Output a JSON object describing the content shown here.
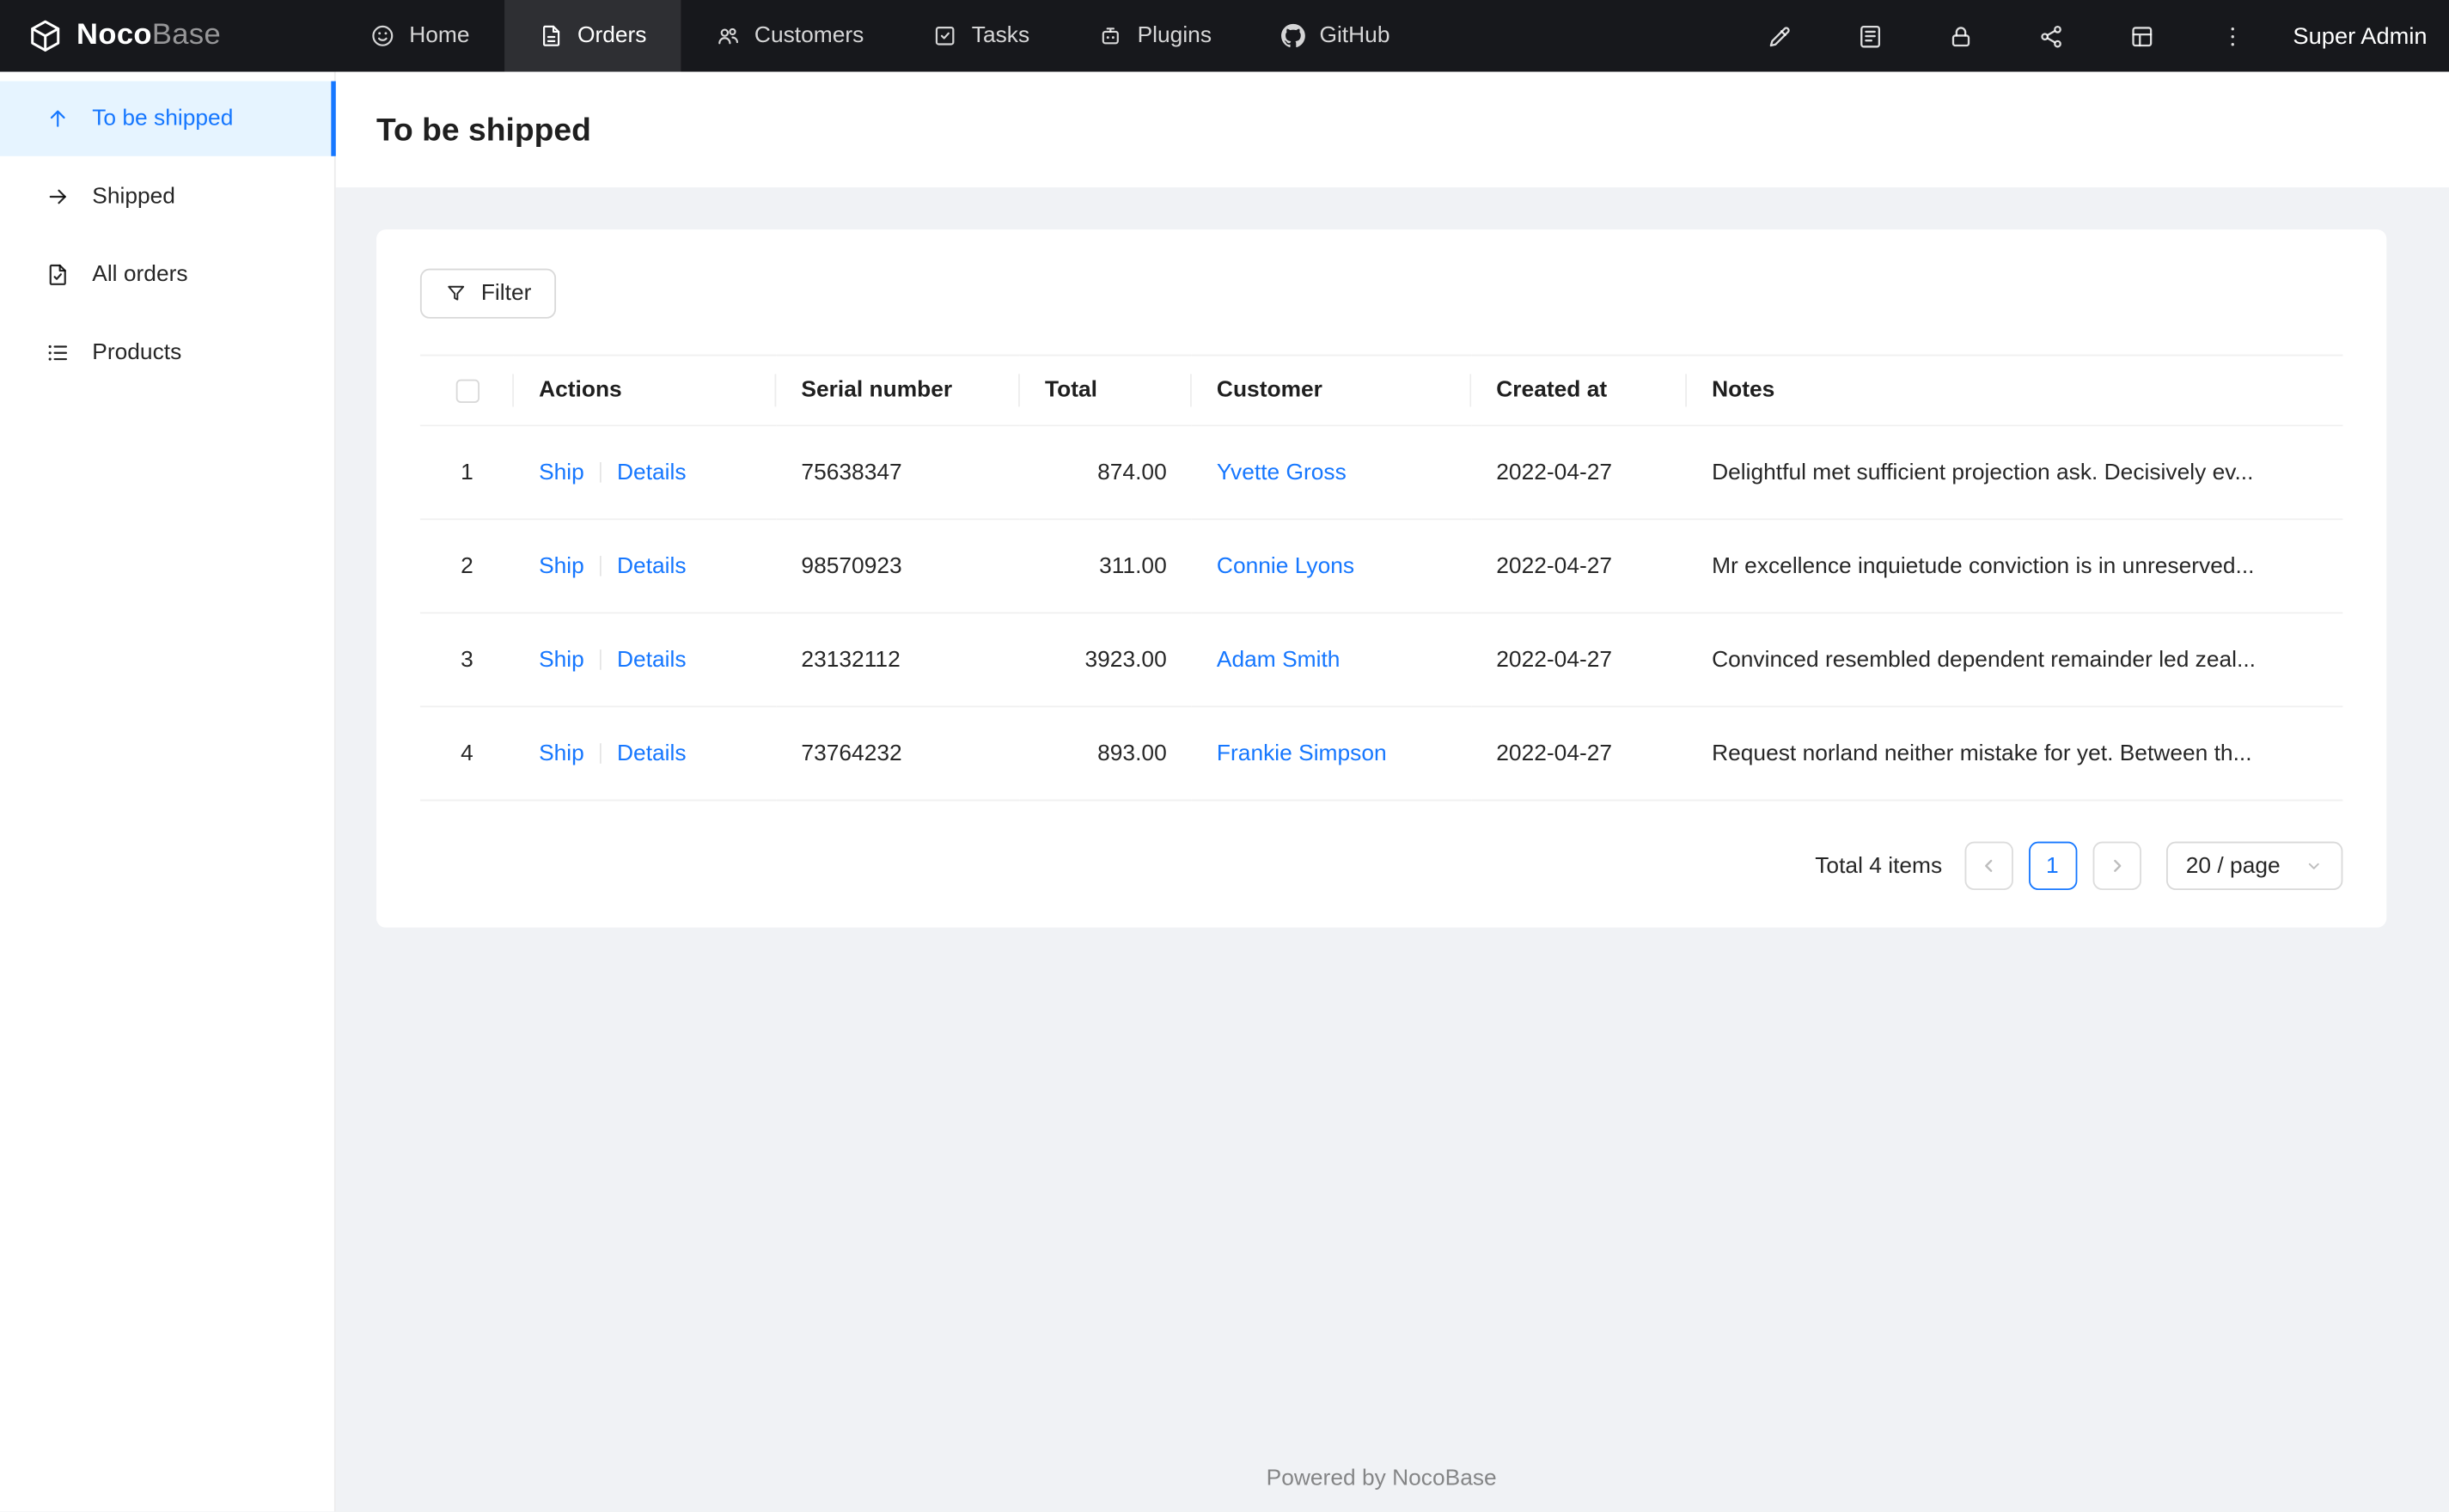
{
  "navbar": {
    "logo": {
      "noco": "Noco",
      "base": "Base",
      "icon": "cube-logo-icon"
    },
    "items": [
      {
        "label": "Home",
        "icon": "smile-icon",
        "active": false
      },
      {
        "label": "Orders",
        "icon": "orders-icon",
        "active": true
      },
      {
        "label": "Customers",
        "icon": "team-icon",
        "active": false
      },
      {
        "label": "Tasks",
        "icon": "check-square-icon",
        "active": false
      },
      {
        "label": "Plugins",
        "icon": "robot-icon",
        "active": false
      },
      {
        "label": "GitHub",
        "icon": "github-icon",
        "active": false
      }
    ],
    "right_icons": [
      "highlighter-icon",
      "collections-icon",
      "lock-icon",
      "share-icon",
      "layout-icon",
      "more-icon"
    ],
    "user": "Super Admin"
  },
  "sidebar": {
    "items": [
      {
        "label": "To be shipped",
        "icon": "arrow-up-icon",
        "active": true
      },
      {
        "label": "Shipped",
        "icon": "arrow-right-icon",
        "active": false
      },
      {
        "label": "All orders",
        "icon": "order-file-icon",
        "active": false
      },
      {
        "label": "Products",
        "icon": "list-icon",
        "active": false
      }
    ]
  },
  "page": {
    "title": "To be shipped"
  },
  "table": {
    "filter_label": "Filter",
    "columns": [
      "Actions",
      "Serial number",
      "Total",
      "Customer",
      "Created at",
      "Notes"
    ],
    "rows": [
      {
        "index": 1,
        "actions": [
          "Ship",
          "Details"
        ],
        "serial": "75638347",
        "total": "874.00",
        "customer": "Yvette Gross",
        "created_at": "2022-04-27",
        "notes": "Delightful met sufficient projection ask. Decisively ev..."
      },
      {
        "index": 2,
        "actions": [
          "Ship",
          "Details"
        ],
        "serial": "98570923",
        "total": "311.00",
        "customer": "Connie Lyons",
        "created_at": "2022-04-27",
        "notes": "Mr excellence inquietude conviction is in unreserved..."
      },
      {
        "index": 3,
        "actions": [
          "Ship",
          "Details"
        ],
        "serial": "23132112",
        "total": "3923.00",
        "customer": "Adam Smith",
        "created_at": "2022-04-27",
        "notes": "Convinced resembled dependent remainder led zeal..."
      },
      {
        "index": 4,
        "actions": [
          "Ship",
          "Details"
        ],
        "serial": "73764232",
        "total": "893.00",
        "customer": "Frankie Simpson",
        "created_at": "2022-04-27",
        "notes": "Request norland neither mistake for yet. Between th..."
      }
    ],
    "pagination": {
      "total_text": "Total 4 items",
      "page": "1",
      "page_size": "20 / page"
    }
  },
  "footer": {
    "text": "Powered by NocoBase"
  },
  "colors": {
    "accent": "#1677ff",
    "navbar_bg": "#17181c",
    "sidebar_active_bg": "#e6f4ff",
    "content_bg": "#f0f2f5",
    "link": "#1677ff"
  }
}
